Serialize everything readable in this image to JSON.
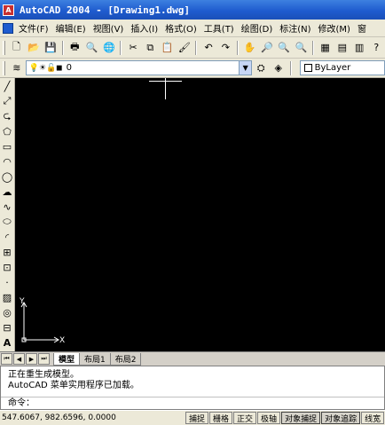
{
  "window": {
    "title": "AutoCAD 2004 - [Drawing1.dwg]"
  },
  "menu": {
    "items": [
      "文件(F)",
      "编辑(E)",
      "视图(V)",
      "插入(I)",
      "格式(O)",
      "工具(T)",
      "绘图(D)",
      "标注(N)",
      "修改(M)",
      "窗"
    ]
  },
  "layers": {
    "current_layer": "0",
    "linetype": "ByLayer"
  },
  "tabs": {
    "model": "模型",
    "layout1": "布局1",
    "layout2": "布局2"
  },
  "ucs": {
    "x_label": "X",
    "y_label": "Y"
  },
  "command": {
    "history": [
      "正在重生成模型。",
      "AutoCAD 菜单实用程序已加载。"
    ],
    "prompt": "命令："
  },
  "status": {
    "coordinates": "547.6067,   982.6596,  0.0000",
    "buttons": [
      "捕捉",
      "栅格",
      "正交",
      "极轴",
      "对象捕捉",
      "对象追踪",
      "线宽"
    ]
  },
  "colors": {
    "canvas": "#000000",
    "titlebar": "#1f5ccf"
  }
}
